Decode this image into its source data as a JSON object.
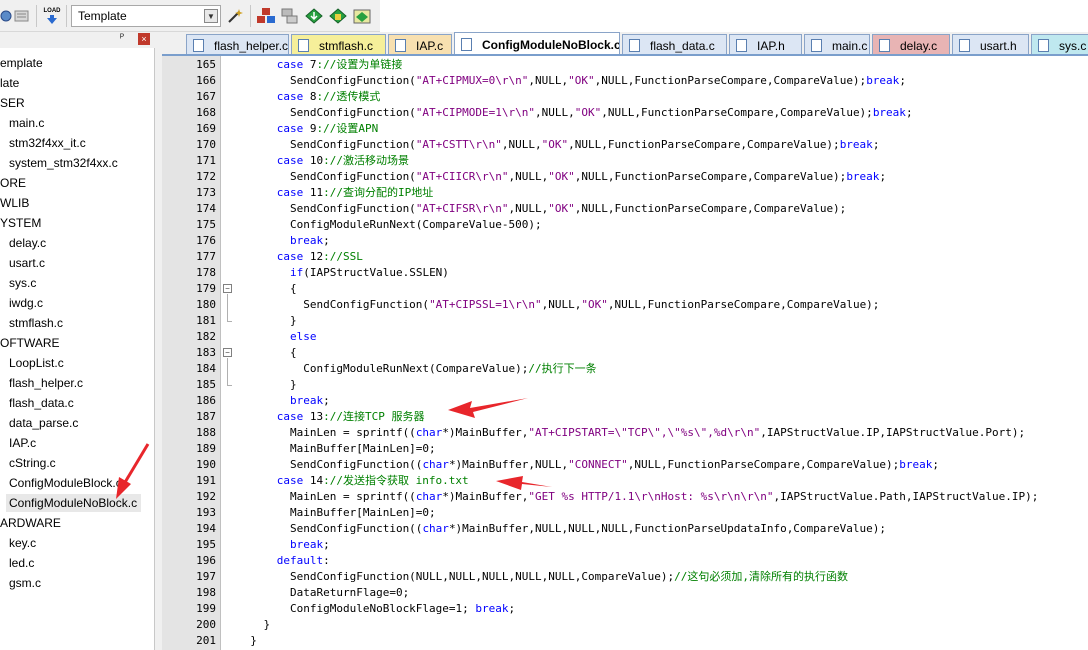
{
  "toolbar": {
    "target": "Template",
    "icons": [
      "build-icon",
      "rebuild-icon",
      "load-icon",
      "wand-icon",
      "pack-installer-icon",
      "manage-icon",
      "diamond-green-icon",
      "diamond-download-icon",
      "pack-icon"
    ],
    "load_label": "LOAD"
  },
  "project_panel": {
    "pin": "ᴾ",
    "close": "×",
    "items": [
      {
        "label": "emplate",
        "indent": 0
      },
      {
        "label": "late",
        "indent": 0
      },
      {
        "label": "SER",
        "indent": 0
      },
      {
        "label": "main.c",
        "indent": 1
      },
      {
        "label": "stm32f4xx_it.c",
        "indent": 1
      },
      {
        "label": "system_stm32f4xx.c",
        "indent": 1
      },
      {
        "label": "ORE",
        "indent": 0
      },
      {
        "label": "WLIB",
        "indent": 0
      },
      {
        "label": "YSTEM",
        "indent": 0
      },
      {
        "label": "delay.c",
        "indent": 1
      },
      {
        "label": "usart.c",
        "indent": 1
      },
      {
        "label": "sys.c",
        "indent": 1
      },
      {
        "label": "iwdg.c",
        "indent": 1
      },
      {
        "label": "stmflash.c",
        "indent": 1
      },
      {
        "label": "OFTWARE",
        "indent": 0
      },
      {
        "label": "LoopList.c",
        "indent": 1
      },
      {
        "label": "flash_helper.c",
        "indent": 1
      },
      {
        "label": "flash_data.c",
        "indent": 1
      },
      {
        "label": "data_parse.c",
        "indent": 1
      },
      {
        "label": "IAP.c",
        "indent": 1
      },
      {
        "label": "cString.c",
        "indent": 1
      },
      {
        "label": "ConfigModuleBlock.c",
        "indent": 1
      },
      {
        "label": "ConfigModuleNoBlock.c",
        "indent": 1,
        "selected": true
      },
      {
        "label": "ARDWARE",
        "indent": 0
      },
      {
        "label": "key.c",
        "indent": 1
      },
      {
        "label": "led.c",
        "indent": 1
      },
      {
        "label": "gsm.c",
        "indent": 1
      }
    ]
  },
  "tabs": [
    {
      "label": "flash_helper.c",
      "bg": "#dce6f4"
    },
    {
      "label": "stmflash.c",
      "bg": "#f6ef9a"
    },
    {
      "label": "IAP.c",
      "bg": "#f8e0b0"
    },
    {
      "label": "ConfigModuleNoBlock.c",
      "bg": "#ffffff",
      "active": true
    },
    {
      "label": "flash_data.c",
      "bg": "#dce6f4"
    },
    {
      "label": "IAP.h",
      "bg": "#dce6f4"
    },
    {
      "label": "main.c",
      "bg": "#dce6f4"
    },
    {
      "label": "delay.c",
      "bg": "#e8b4b4"
    },
    {
      "label": "usart.h",
      "bg": "#dce6f4"
    },
    {
      "label": "sys.c",
      "bg": "#bfe8ef"
    }
  ],
  "code_lines": [
    {
      "n": "165",
      "t": [
        [
          "kw",
          "      case "
        ],
        [
          "nm",
          "7"
        ],
        [
          "cm",
          ":"
        ],
        [
          "cm",
          "//设置为单链接"
        ]
      ]
    },
    {
      "n": "166",
      "t": [
        [
          "nm",
          "        SendConfigFunction("
        ],
        [
          "st",
          "\"AT+CIPMUX=0\\r\\n\""
        ],
        [
          "nm",
          ",NULL,"
        ],
        [
          "st",
          "\"OK\""
        ],
        [
          "nm",
          ",NULL,FunctionParseCompare,CompareValue);"
        ],
        [
          "kw",
          "break"
        ],
        [
          "nm",
          ";"
        ]
      ]
    },
    {
      "n": "167",
      "t": [
        [
          "kw",
          "      case "
        ],
        [
          "nm",
          "8"
        ],
        [
          "cm",
          ":"
        ],
        [
          "cm",
          "//透传模式"
        ]
      ]
    },
    {
      "n": "168",
      "t": [
        [
          "nm",
          "        SendConfigFunction("
        ],
        [
          "st",
          "\"AT+CIPMODE=1\\r\\n\""
        ],
        [
          "nm",
          ",NULL,"
        ],
        [
          "st",
          "\"OK\""
        ],
        [
          "nm",
          ",NULL,FunctionParseCompare,CompareValue);"
        ],
        [
          "kw",
          "break"
        ],
        [
          "nm",
          ";"
        ]
      ]
    },
    {
      "n": "169",
      "t": [
        [
          "kw",
          "      case "
        ],
        [
          "nm",
          "9"
        ],
        [
          "cm",
          ":"
        ],
        [
          "cm",
          "//设置APN"
        ]
      ]
    },
    {
      "n": "170",
      "t": [
        [
          "nm",
          "        SendConfigFunction("
        ],
        [
          "st",
          "\"AT+CSTT\\r\\n\""
        ],
        [
          "nm",
          ",NULL,"
        ],
        [
          "st",
          "\"OK\""
        ],
        [
          "nm",
          ",NULL,FunctionParseCompare,CompareValue);"
        ],
        [
          "kw",
          "break"
        ],
        [
          "nm",
          ";"
        ]
      ]
    },
    {
      "n": "171",
      "t": [
        [
          "kw",
          "      case "
        ],
        [
          "nm",
          "10"
        ],
        [
          "cm",
          ":"
        ],
        [
          "cm",
          "//激活移动场景"
        ]
      ]
    },
    {
      "n": "172",
      "t": [
        [
          "nm",
          "        SendConfigFunction("
        ],
        [
          "st",
          "\"AT+CIICR\\r\\n\""
        ],
        [
          "nm",
          ",NULL,"
        ],
        [
          "st",
          "\"OK\""
        ],
        [
          "nm",
          ",NULL,FunctionParseCompare,CompareValue);"
        ],
        [
          "kw",
          "break"
        ],
        [
          "nm",
          ";"
        ]
      ]
    },
    {
      "n": "173",
      "t": [
        [
          "kw",
          "      case "
        ],
        [
          "nm",
          "11"
        ],
        [
          "cm",
          ":"
        ],
        [
          "cm",
          "//查询分配的IP地址"
        ]
      ]
    },
    {
      "n": "174",
      "t": [
        [
          "nm",
          "        SendConfigFunction("
        ],
        [
          "st",
          "\"AT+CIFSR\\r\\n\""
        ],
        [
          "nm",
          ",NULL,"
        ],
        [
          "st",
          "\"OK\""
        ],
        [
          "nm",
          ",NULL,FunctionParseCompare,CompareValue);"
        ]
      ]
    },
    {
      "n": "175",
      "t": [
        [
          "nm",
          "        ConfigModuleRunNext(CompareValue-500);"
        ]
      ]
    },
    {
      "n": "176",
      "t": [
        [
          "kw",
          "        break"
        ],
        [
          "nm",
          ";"
        ]
      ]
    },
    {
      "n": "177",
      "t": [
        [
          "kw",
          "      case "
        ],
        [
          "nm",
          "12"
        ],
        [
          "cm",
          ":"
        ],
        [
          "cm",
          "//SSL"
        ]
      ]
    },
    {
      "n": "178",
      "t": [
        [
          "kw",
          "        if"
        ],
        [
          "nm",
          "(IAPStructValue.SSLEN)"
        ]
      ]
    },
    {
      "n": "179",
      "t": [
        [
          "nm",
          "        {"
        ]
      ],
      "fold": "open"
    },
    {
      "n": "180",
      "t": [
        [
          "nm",
          "          SendConfigFunction("
        ],
        [
          "st",
          "\"AT+CIPSSL=1\\r\\n\""
        ],
        [
          "nm",
          ",NULL,"
        ],
        [
          "st",
          "\"OK\""
        ],
        [
          "nm",
          ",NULL,FunctionParseCompare,CompareValue);"
        ]
      ]
    },
    {
      "n": "181",
      "t": [
        [
          "nm",
          "        }"
        ]
      ],
      "fold": "end"
    },
    {
      "n": "182",
      "t": [
        [
          "kw",
          "        else"
        ]
      ]
    },
    {
      "n": "183",
      "t": [
        [
          "nm",
          "        {"
        ]
      ],
      "fold": "open"
    },
    {
      "n": "184",
      "t": [
        [
          "nm",
          "          ConfigModuleRunNext(CompareValue);"
        ],
        [
          "cm",
          "//执行下一条"
        ]
      ]
    },
    {
      "n": "185",
      "t": [
        [
          "nm",
          "        }"
        ]
      ],
      "fold": "end"
    },
    {
      "n": "186",
      "t": [
        [
          "kw",
          "        break"
        ],
        [
          "nm",
          ";"
        ]
      ]
    },
    {
      "n": "187",
      "t": [
        [
          "kw",
          "      case "
        ],
        [
          "nm",
          "13"
        ],
        [
          "cm",
          ":"
        ],
        [
          "cm",
          "//连接TCP 服务器"
        ]
      ]
    },
    {
      "n": "188",
      "t": [
        [
          "nm",
          "        MainLen = sprintf(("
        ],
        [
          "kw",
          "char"
        ],
        [
          "nm",
          "*)MainBuffer,"
        ],
        [
          "st",
          "\"AT+CIPSTART=\\\"TCP\\\",\\\"%s\\\",%d\\r\\n\""
        ],
        [
          "nm",
          ",IAPStructValue.IP,IAPStructValue.Port);"
        ]
      ]
    },
    {
      "n": "189",
      "t": [
        [
          "nm",
          "        MainBuffer[MainLen]=0;"
        ]
      ]
    },
    {
      "n": "190",
      "t": [
        [
          "nm",
          "        SendConfigFunction(("
        ],
        [
          "kw",
          "char"
        ],
        [
          "nm",
          "*)MainBuffer,NULL,"
        ],
        [
          "st",
          "\"CONNECT\""
        ],
        [
          "nm",
          ",NULL,FunctionParseCompare,CompareValue);"
        ],
        [
          "kw",
          "break"
        ],
        [
          "nm",
          ";"
        ]
      ]
    },
    {
      "n": "191",
      "t": [
        [
          "kw",
          "      case "
        ],
        [
          "nm",
          "14"
        ],
        [
          "cm",
          ":"
        ],
        [
          "cm",
          "//发送指令获取 info.txt"
        ]
      ]
    },
    {
      "n": "192",
      "t": [
        [
          "nm",
          "        MainLen = sprintf(("
        ],
        [
          "kw",
          "char"
        ],
        [
          "nm",
          "*)MainBuffer,"
        ],
        [
          "st",
          "\"GET %s HTTP/1.1\\r\\nHost: %s\\r\\n\\r\\n\""
        ],
        [
          "nm",
          ",IAPStructValue.Path,IAPStructValue.IP);"
        ]
      ]
    },
    {
      "n": "193",
      "t": [
        [
          "nm",
          "        MainBuffer[MainLen]=0;"
        ]
      ]
    },
    {
      "n": "194",
      "t": [
        [
          "nm",
          "        SendConfigFunction(("
        ],
        [
          "kw",
          "char"
        ],
        [
          "nm",
          "*)MainBuffer,NULL,NULL,NULL,FunctionParseUpdataInfo,CompareValue);"
        ]
      ]
    },
    {
      "n": "195",
      "t": [
        [
          "kw",
          "        break"
        ],
        [
          "nm",
          ";"
        ]
      ]
    },
    {
      "n": "196",
      "t": [
        [
          "kw",
          "      default"
        ],
        [
          "nm",
          ":"
        ]
      ]
    },
    {
      "n": "197",
      "t": [
        [
          "nm",
          "        SendConfigFunction(NULL,NULL,NULL,NULL,NULL,CompareValue);"
        ],
        [
          "cm",
          "//这句必须加,清除所有的执行函数"
        ]
      ]
    },
    {
      "n": "198",
      "t": [
        [
          "nm",
          "        DataReturnFlage=0;"
        ]
      ]
    },
    {
      "n": "199",
      "t": [
        [
          "nm",
          "        ConfigModuleNoBlockFlage=1; "
        ],
        [
          "kw",
          "break"
        ],
        [
          "nm",
          ";"
        ]
      ]
    },
    {
      "n": "200",
      "t": [
        [
          "nm",
          "    }"
        ]
      ]
    },
    {
      "n": "201",
      "t": [
        [
          "nm",
          "  }"
        ]
      ]
    }
  ],
  "colors": {
    "keyword": "#0000ff",
    "comment": "#008000",
    "string": "#800080",
    "annotation_arrow": "#e8262b"
  }
}
